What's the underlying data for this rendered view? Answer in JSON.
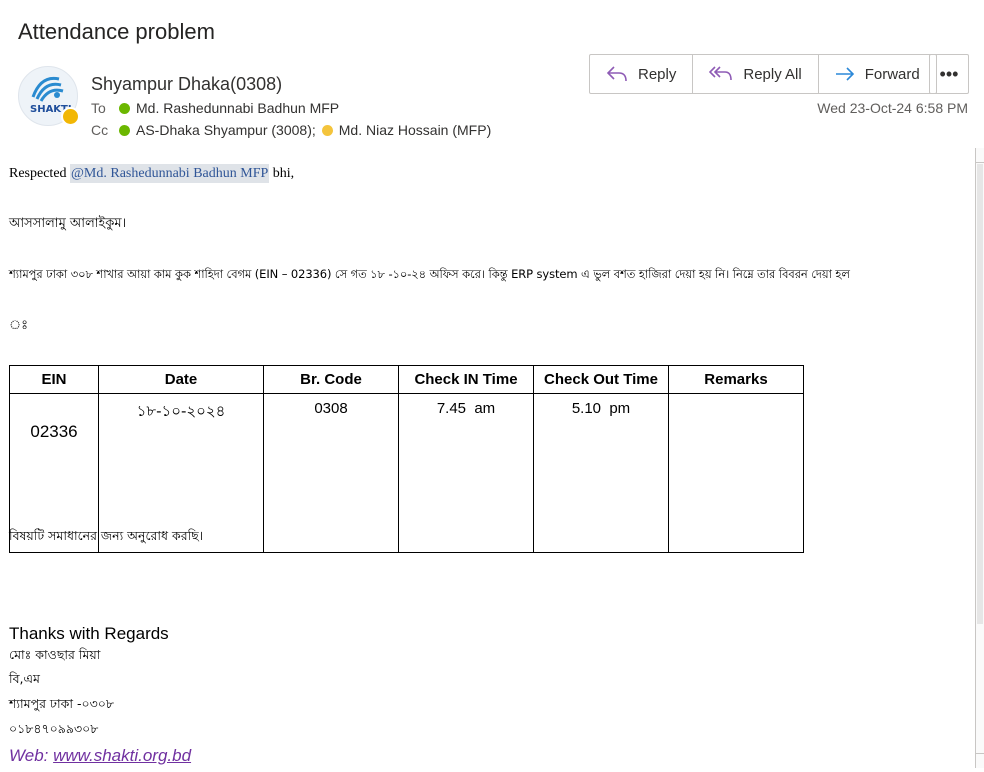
{
  "subject": "Attendance problem",
  "sender": "Shyampur Dhaka(0308)",
  "avatar": {
    "logo_text": "SHAKTI",
    "presence_color": "#f2b705"
  },
  "to": {
    "label": "To",
    "recipients": [
      "Md. Rashedunnabi Badhun MFP"
    ]
  },
  "cc": {
    "label": "Cc",
    "recipients": [
      "AS-Dhaka Shyampur (3008);",
      "Md. Niaz Hossain (MFP)"
    ]
  },
  "actions": {
    "reply": "Reply",
    "reply_all": "Reply All",
    "forward": "Forward",
    "more": "•••"
  },
  "date": "Wed 23-Oct-24 6:58 PM",
  "body": {
    "greeting_prefix": "Respected ",
    "mention": "@Md. Rashedunnabi Badhun MFP",
    "greeting_suffix": " bhi,",
    "salam": "আসসালামু আলাইকুম।",
    "para": "শ্যামপুর ঢাকা ৩০৮ শাখার আয়া কাম কুক শাহিদা বেগম (EIN – 02336) সে গত ১৮ -১০-২৪ অফিস করে। কিন্তু ERP system এ ভুল বশত হাজিরা দেয়া হয় নি। নিম্নে তার বিবরন দেয়া হল",
    "colon": "ঃ",
    "closing": "বিষয়টি সমাধানের জন্য অনুরোধ করছি।"
  },
  "table": {
    "headers": [
      "EIN",
      "Date",
      "Br. Code",
      "Check IN Time",
      "Check Out Time",
      "Remarks"
    ],
    "row": [
      "02336",
      "১৮-১০-২০২৪",
      "0308",
      "7.45  am",
      "5.10  pm",
      ""
    ]
  },
  "signature": {
    "regards": "Thanks with Regards",
    "name": "মোঃ কাওছার মিয়া",
    "title": "বি,এম",
    "branch": "শ্যামপুর ঢাকা -০৩০৮",
    "phone": "০১৮৪৭০৯৯৩০৮",
    "web_label": "Web: ",
    "web_url": "www.shakti.org.bd"
  },
  "colors": {
    "accent_purple": "#7030a0",
    "mention_blue": "#2f5597",
    "online_green": "#6bb700"
  }
}
